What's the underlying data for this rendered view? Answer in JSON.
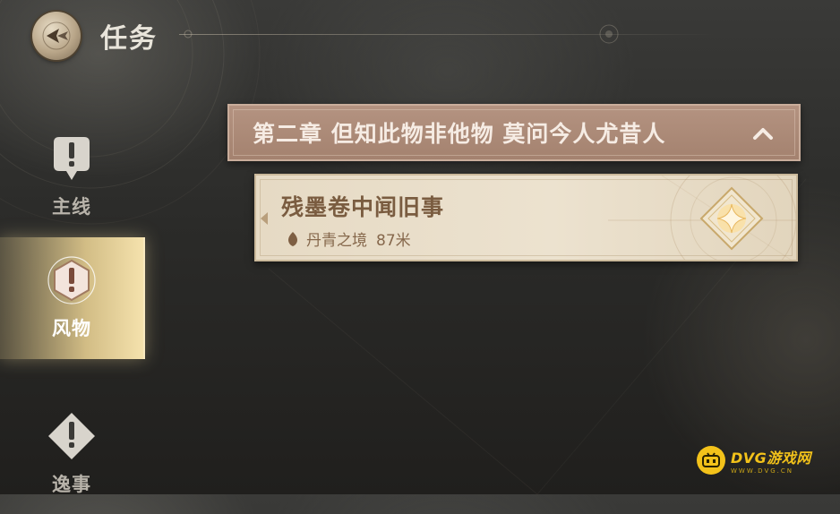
{
  "header": {
    "title": "任务"
  },
  "nav": {
    "items": [
      {
        "label": "主线",
        "icon": "exclamation-bubble-icon",
        "active": false
      },
      {
        "label": "风物",
        "icon": "exclamation-hexagon-icon",
        "active": true
      },
      {
        "label": "逸事",
        "icon": "exclamation-diamond-icon",
        "active": false
      }
    ]
  },
  "chapter": {
    "title": "第二章 但知此物非他物 莫问今人尤昔人",
    "expanded": true
  },
  "quest": {
    "title": "残墨卷中闻旧事",
    "location": "丹青之境",
    "distance": "87米"
  },
  "watermark": {
    "name": "DVG游戏网",
    "url": "WWW.DVG.CN"
  },
  "colors": {
    "chapter_bar": "#a88572",
    "quest_card": "#e9dfcb",
    "active_tab": "#f5e2ad",
    "title_text": "#e8e4da"
  }
}
